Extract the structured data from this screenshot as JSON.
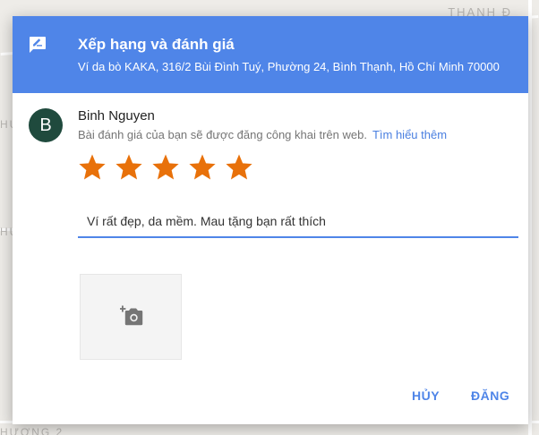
{
  "map": {
    "label_top_right": "THANH Đ",
    "label_left_1": "HU",
    "label_left_2": "HU",
    "label_bottom": "HƯƠNG 2"
  },
  "dialog": {
    "title": "Xếp hạng và đánh giá",
    "subtitle": "Ví da bò KAKA, 316/2 Bùi Đình Tuý, Phường 24, Bình Thạnh, Hồ Chí Minh 70000",
    "header_icon": "rate-review-icon",
    "user": {
      "avatar_letter": "B",
      "avatar_color": "#1f4a3d",
      "name": "Binh Nguyen",
      "notice": "Bài đánh giá của bạn sẽ được đăng công khai trên web.",
      "learn_more": "Tìm hiểu thêm"
    },
    "rating": {
      "value": 5,
      "max": 5,
      "star_color": "#e8710a"
    },
    "review": {
      "value": "Ví rất đẹp, da mềm. Mau tặng bạn rất thích"
    },
    "photo": {
      "icon": "add-photo-camera-icon"
    },
    "actions": {
      "cancel": "HỦY",
      "post": "ĐĂNG"
    },
    "accent_color": "#4f85e8"
  }
}
